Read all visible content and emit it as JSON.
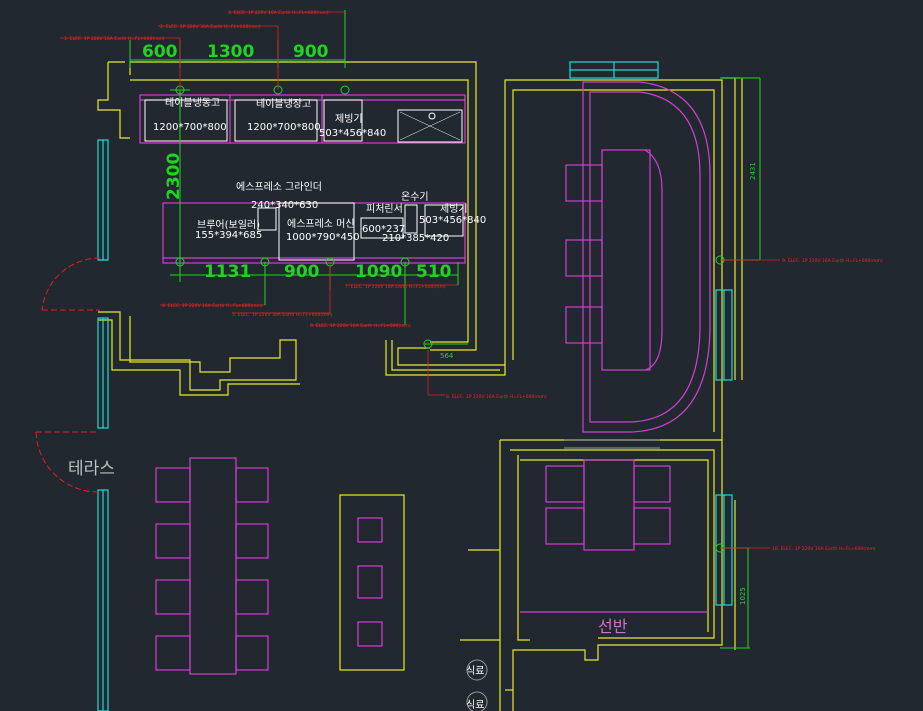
{
  "dimensions_top": [
    "600",
    "1300",
    "900"
  ],
  "dimension_side": "2300",
  "dimensions_bottom": [
    "1131",
    "900",
    "1090",
    "510"
  ],
  "dimension_small": "564",
  "dimension_right_upper": "2431",
  "dimension_right_lower": "1025",
  "equipment": {
    "fridge1_name": "테이블냉동고",
    "fridge1_size": "1200*700*800",
    "fridge2_name": "테이블냉장고",
    "fridge2_size": "1200*700*800",
    "ice1_name": "제빙기",
    "ice1_size": "503*456*840",
    "grinder_name": "에스프레소 그라인더",
    "grinder_size": "240*340*630",
    "brewer_name": "브루어(보일러)",
    "brewer_size": "155*394*685",
    "espresso_name": "에스프레소 머신",
    "espresso_size": "1000*790*450",
    "pitcher_name": "피처린서",
    "pitcher_size": "600*237",
    "hot_water_name": "온수기",
    "hot_water_size": "210*385*420",
    "ice2_name": "제빙기",
    "ice2_size": "503*456*840"
  },
  "rooms": {
    "terrace": "테라스",
    "shelf": "선반",
    "stair1": "식료",
    "stair2": "식료"
  },
  "notes": {
    "n1": "1. ELEC. 1P 220V 16A Earth H=FL+600(mm)",
    "n2": "2. ELEC. 1P 220V 30A Earth H=FL+600(mm)",
    "n3": "3. ELEC. 1P 220V 16A Earth H=FL+600(mm)",
    "n4": "4. ELEC. 1P 220V 16A Earth H=FL+600(mm)",
    "n5": "5. ELEC. 1P 220V 30A Earth H=FL+600(mm)",
    "n6": "6. ELEC. 1P 220V 16A Earth H=FL+600(mm)",
    "n7": "7. ELEC. 1P 220V 16A Earth H=FL+600(mm)",
    "n8": "8. ELEC. 1P 220V 16A Earth H=FL+600(mm)",
    "n9": "9. ELEC. 1P 220V 16A Earth H=FL+600(mm)",
    "n10": "10. ELEC. 1P 220V 16A Earth H=FL+600(mm)"
  }
}
